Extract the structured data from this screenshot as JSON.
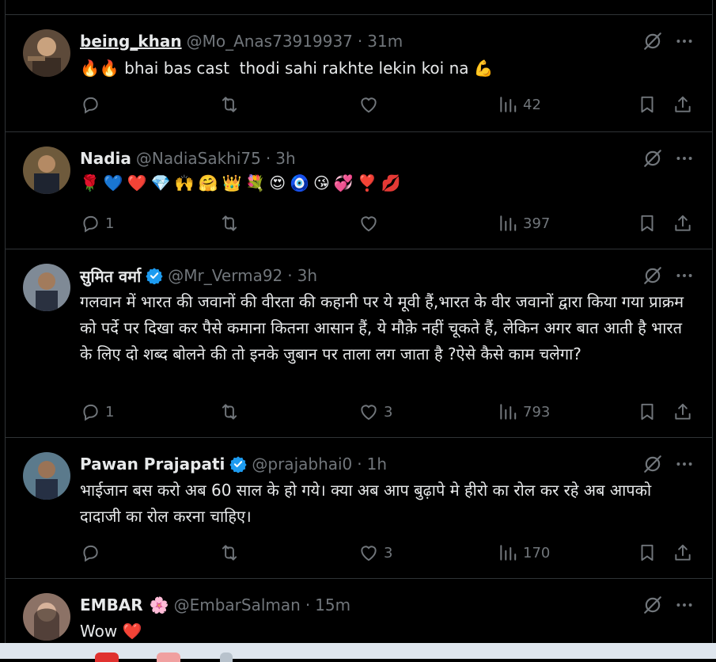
{
  "tweets": [
    {
      "name": "being_khan",
      "handle": "@Mo_Anas73919937",
      "time": "31m",
      "text": "🔥🔥 bhai bas cast  thodi sahi rakhte lekin koi na 💪",
      "replies": "",
      "retweets": "",
      "likes": "",
      "views": "42"
    },
    {
      "name": "Nadia",
      "handle": "@NadiaSakhi75",
      "time": "3h",
      "emojis": [
        "🌹",
        "💙",
        "❤️",
        "💎",
        "🙌",
        "🤗",
        "👑",
        "💐",
        "😍",
        "🧿",
        "😘",
        "💞",
        "❣️",
        "💋"
      ],
      "replies": "1",
      "retweets": "",
      "likes": "",
      "views": "397"
    },
    {
      "name": "सुमित वर्मा",
      "handle": "@Mr_Verma92",
      "time": "3h",
      "text": "गलवान में भारत की जवानों की वीरता की कहानी पर ये मूवी हैं,भारत के वीर जवानों द्वारा किया गया प्राक्रम को पर्दे पर दिखा कर पैसे कमाना कितना आसान हैं, ये मौक़े नहीं चूकते हैं, लेकिन अगर बात आती है भारत के लिए दो शब्द बोलने की तो इनके जुबान पर ताला लग जाता है ?ऐसे कैसे काम चलेगा?",
      "replies": "1",
      "retweets": "",
      "likes": "3",
      "views": "793"
    },
    {
      "name": "Pawan Prajapati",
      "handle": "@prajabhai0",
      "time": "1h",
      "text": "भाईजान बस करो अब 60 साल के हो गये। क्या अब आप बुढ़ापे मे हीरो का रोल कर रहे अब आपको दादाजी का रोल करना चाहिए।",
      "replies": "",
      "retweets": "",
      "likes": "3",
      "views": "170"
    },
    {
      "name": "EMBAR",
      "name_emoji": "🌸",
      "handle": "@EmbarSalman",
      "time": "15m",
      "text": "Wow ❤️"
    }
  ],
  "separator": "·",
  "icons": {
    "reply": "reply-icon",
    "retweet": "retweet-icon",
    "like": "heart-icon",
    "views": "views-icon",
    "bookmark": "bookmark-icon",
    "share": "share-icon",
    "grok": "grok-icon",
    "more": "more-icon",
    "verified": "verified-badge-icon"
  },
  "colors": {
    "background": "#000000",
    "text": "#e7e9ea",
    "muted": "#71767b",
    "border": "#2f3336",
    "verified": "#1d9bf0"
  }
}
